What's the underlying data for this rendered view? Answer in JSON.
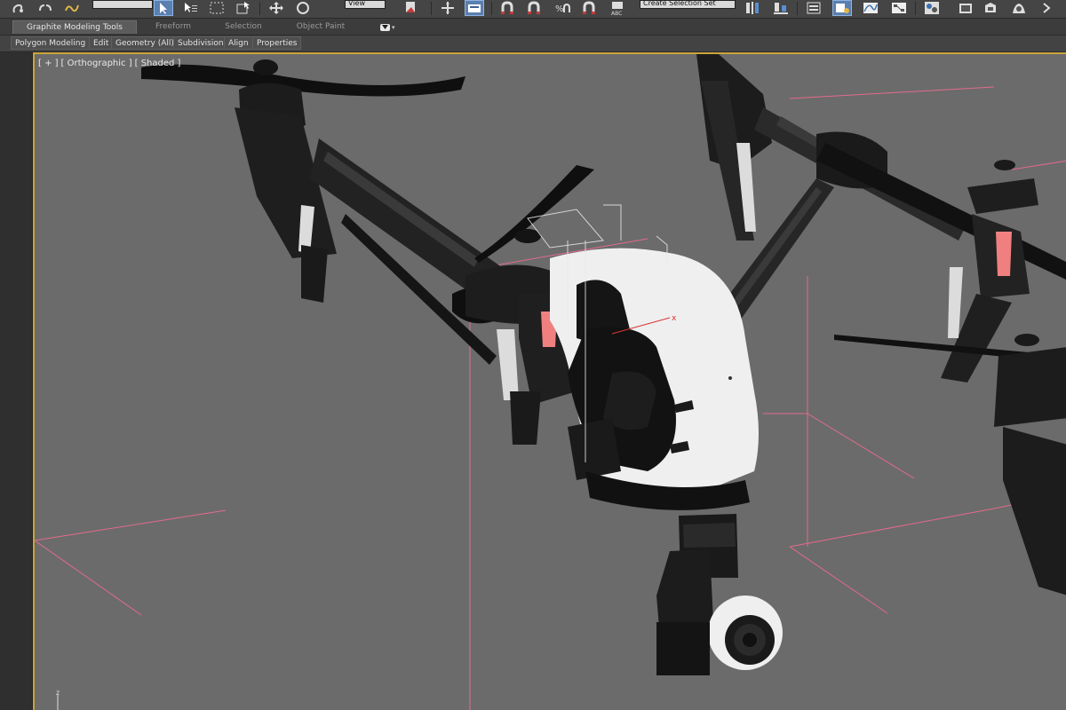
{
  "toolbar": {
    "selection_filter_value": "",
    "ref_coord_value": "View",
    "named_selection_value": "Create Selection Set"
  },
  "ribbon": {
    "tabs": [
      {
        "label": "Graphite Modeling Tools",
        "active": true
      },
      {
        "label": "Freeform",
        "active": false
      },
      {
        "label": "Selection",
        "active": false
      },
      {
        "label": "Object Paint",
        "active": false
      }
    ],
    "panels": [
      "Polygon Modeling",
      "Edit",
      "Geometry (All)",
      "Subdivision",
      "Align",
      "Properties"
    ]
  },
  "viewport": {
    "label_plus": "[ + ]",
    "label_view": "[ Orthographic ]",
    "label_shading": "[ Shaded ]",
    "pivot_axis": "x",
    "gizmo_axis": "z"
  },
  "colors": {
    "viewport_bg": "#6b6b6b",
    "bounding_box": "#e36b8c",
    "active_border": "#caa53b",
    "drone_body": "#efefef",
    "drone_dark": "#1c1c1c",
    "indicator_light": "#f08080"
  }
}
